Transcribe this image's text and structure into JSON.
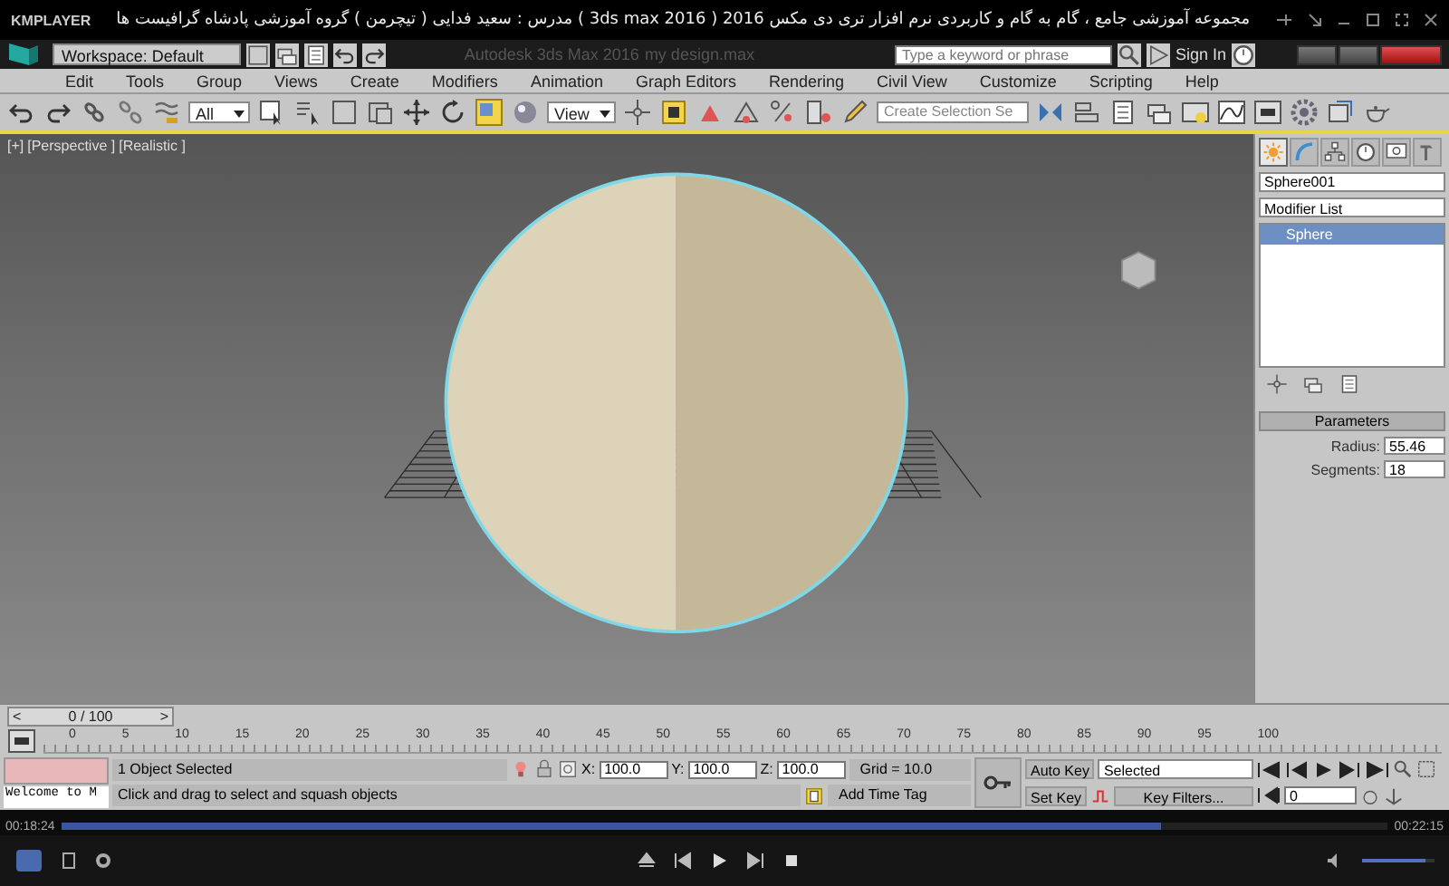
{
  "player": {
    "logo": "KMPLAYER",
    "title": "مجموعه آموزشی جامع ، گام به گام و کاربردی نرم افزار تری دی مکس 2016 ( 3ds max 2016 ) مدرس : سعید فدایی ( تیچرمن ) گروه آموزشی پادشاه گرافیست ها",
    "time_elapsed": "00:18:24",
    "time_total": "00:22:15",
    "progress": {
      "level": 0.83
    },
    "volume": {
      "level": 0.88
    }
  },
  "app": {
    "workspace": "Workspace: Default",
    "title": "Autodesk 3ds Max 2016",
    "file": "my design.max",
    "search": {
      "placeholder": "Type a keyword or phrase"
    },
    "sign_in": "Sign In",
    "menu": [
      "Edit",
      "Tools",
      "Group",
      "Views",
      "Create",
      "Modifiers",
      "Animation",
      "Graph Editors",
      "Rendering",
      "Civil View",
      "Customize",
      "Scripting",
      "Help"
    ],
    "toolbar": {
      "selection_filter": "All",
      "reference_coord": "View",
      "selection_set": {
        "placeholder": "Create Selection Se"
      }
    }
  },
  "viewport": {
    "labels": [
      "[+]",
      "[Perspective ]",
      "[Realistic ]"
    ]
  },
  "command_panel": {
    "tabs": [
      {
        "kind": "create",
        "selected": true
      },
      {
        "kind": "modify",
        "selected": false
      },
      {
        "kind": "hierarchy",
        "selected": false
      },
      {
        "kind": "motion",
        "selected": false
      },
      {
        "kind": "display",
        "selected": false
      },
      {
        "kind": "utilities",
        "selected": false
      }
    ],
    "object_name": "Sphere001",
    "modifier_list": "Modifier List",
    "stack": [
      {
        "label": "Sphere",
        "selected": true
      }
    ],
    "rollout": "Parameters",
    "params": [
      {
        "label": "Radius:",
        "value": "55.46"
      },
      {
        "label": "Segments:",
        "value": "18"
      }
    ]
  },
  "time_slider": {
    "prev": "<",
    "label": "0 / 100",
    "next": ">",
    "level": 0
  },
  "track_bar": {
    "ticks": [
      "0",
      "5",
      "10",
      "15",
      "20",
      "25",
      "30",
      "35",
      "40",
      "45",
      "50",
      "55",
      "60",
      "65",
      "70",
      "75",
      "80",
      "85",
      "90",
      "95",
      "100"
    ]
  },
  "status": {
    "listener": "Welcome to M",
    "selection": "1 Object Selected",
    "prompt": "Click and drag to select and squash objects",
    "coords": [
      {
        "axis": "X:",
        "value": "100.0"
      },
      {
        "axis": "Y:",
        "value": "100.0"
      },
      {
        "axis": "Z:",
        "value": "100.0"
      }
    ],
    "grid": "Grid = 10.0",
    "add_time_tag": "Add Time Tag",
    "auto_key": "Auto Key",
    "key_mode": "Selected",
    "set_key": "Set Key",
    "key_filters": "Key Filters...",
    "frame": "0"
  }
}
